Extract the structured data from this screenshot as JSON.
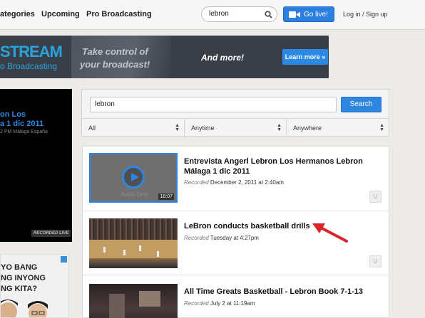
{
  "nav": {
    "links": [
      "ategories",
      "Upcoming",
      "Pro Broadcasting"
    ],
    "search_value": "lebron",
    "golive_label": "Go live!",
    "login_label": "Log in / Sign up"
  },
  "banner": {
    "brand": "STREAM",
    "brand_sub": "o Broadcasting",
    "tagline_1": "Take control of",
    "tagline_2": "your broadcast!",
    "and_more": "And more!",
    "learn_more": "Learn more »"
  },
  "player": {
    "title_1": "on Los",
    "title_2": "a 1 dic 2011",
    "meta": "2 PM Málaga España",
    "recorded_badge": "RECORDED LIVE"
  },
  "ad": {
    "line_1": "YO BANG",
    "line_2": "NG INYONG",
    "line_3": "NG KITA?"
  },
  "search": {
    "query": "lebron",
    "button_label": "Search",
    "filters": [
      "All",
      "Anytime",
      "Anywhere"
    ]
  },
  "results": [
    {
      "title": "Entrevista Angerl Lebron Los Hermanos Lebron Málaga 1 dic 2011",
      "recorded_label": "Recorded",
      "recorded_value": "December 2, 2011 at 2:40am",
      "thumb_text": "Audio Only",
      "duration": "18:07",
      "u_label": "U"
    },
    {
      "title": "LeBron conducts basketball drills",
      "recorded_label": "Recorded",
      "recorded_value": "Tuesday at 4:27pm",
      "u_label": "U"
    },
    {
      "title": "All Time Greats Basketball - Lebron Book 7-1-13",
      "recorded_label": "Recorded",
      "recorded_value": "July 2 at 11:19am"
    }
  ],
  "colors": {
    "accent": "#2f86e0",
    "annotation_arrow": "#d9252a"
  }
}
